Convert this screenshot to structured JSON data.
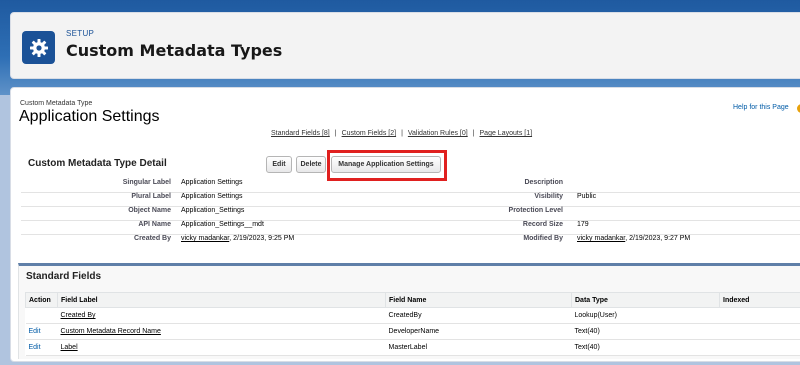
{
  "header": {
    "section_label": "SETUP",
    "title": "Custom Metadata Types"
  },
  "record": {
    "type_label": "Custom Metadata Type",
    "title": "Application Settings",
    "help_link": "Help for this Page"
  },
  "related_links": [
    "Standard Fields [8]",
    "Custom Fields [2]",
    "Validation Rules [0]",
    "Page Layouts [1]"
  ],
  "detail": {
    "heading": "Custom Metadata Type Detail",
    "buttons": {
      "edit": "Edit",
      "delete": "Delete",
      "manage": "Manage Application Settings"
    },
    "left": [
      {
        "label": "Singular Label",
        "value": "Application Settings"
      },
      {
        "label": "Plural Label",
        "value": "Application Settings"
      },
      {
        "label": "Object Name",
        "value": "Application_Settings"
      },
      {
        "label": "API Name",
        "value": "Application_Settings__mdt"
      },
      {
        "label": "Created By",
        "user": "vicky madankar",
        "value": ", 2/19/2023, 9:25 PM"
      }
    ],
    "right": [
      {
        "label": "Description",
        "value": ""
      },
      {
        "label": "Visibility",
        "value": "Public"
      },
      {
        "label": "Protection Level",
        "value": ""
      },
      {
        "label": "Record Size",
        "value": "179"
      },
      {
        "label": "Modified By",
        "user": "vicky madankar",
        "value": ", 2/19/2023, 9:27 PM"
      }
    ]
  },
  "standard_fields": {
    "title": "Standard Fields",
    "columns": [
      "Action",
      "Field Label",
      "Field Name",
      "Data Type",
      "Indexed"
    ],
    "rows": [
      {
        "action": "",
        "label": "Created By",
        "name": "CreatedBy",
        "type": "Lookup(User)",
        "indexed": ""
      },
      {
        "action": "Edit",
        "label": "Custom Metadata Record Name",
        "name": "DeveloperName",
        "type": "Text(40)",
        "indexed": ""
      },
      {
        "action": "Edit",
        "label": "Label",
        "name": "MasterLabel",
        "type": "Text(40)",
        "indexed": ""
      }
    ]
  },
  "colors": {
    "brand": "#1b5297",
    "link": "#015ba7",
    "highlight": "#e0201f"
  },
  "icons": {
    "setup": "gear-icon"
  }
}
